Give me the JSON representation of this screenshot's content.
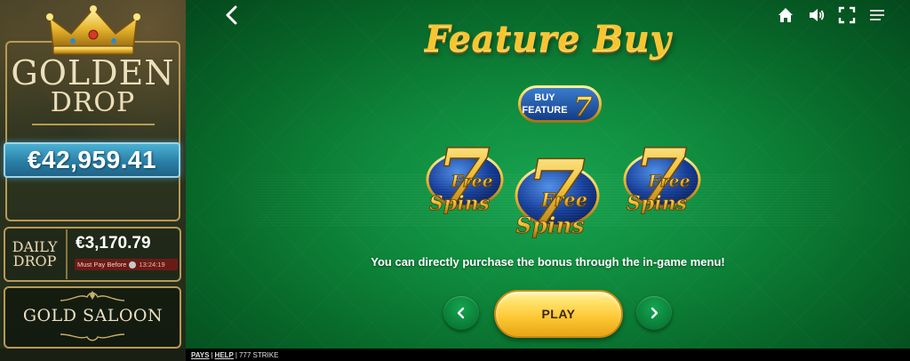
{
  "jackpots": {
    "golden_drop": {
      "line1": "GOLDEN",
      "line2": "DROP",
      "amount": "€42,959.41"
    },
    "daily_drop": {
      "label_line1": "DAILY",
      "label_line2": "DROP",
      "amount": "€3,170.79",
      "must_pay_text": "Must Pay Before",
      "timer": "13:24:19"
    },
    "gold_saloon": {
      "title": "GOLD SALOON"
    }
  },
  "top_bar": {
    "icons": [
      "back-icon",
      "home-icon",
      "sound-icon",
      "fullscreen-icon",
      "menu-icon"
    ]
  },
  "feature": {
    "title": "Feature Buy",
    "badge_line1": "BUY",
    "badge_line2": "FEATURE",
    "badge_number": "7",
    "free_spins_icons": [
      {
        "word1": "Free",
        "word2": "Spins",
        "number": "7"
      },
      {
        "word1": "Free",
        "word2": "Spins",
        "number": "7"
      },
      {
        "word1": "Free",
        "word2": "Spins",
        "number": "7"
      }
    ],
    "description": "You can directly purchase the bonus through the in-game menu!"
  },
  "controls": {
    "play_label": "PLAY",
    "prev_icon": "chevron-left-icon",
    "next_icon": "chevron-right-icon"
  },
  "footer": {
    "pays": "PAYS",
    "help": "HELP",
    "separator": "|",
    "game_name": "777 STRIKE"
  },
  "colors": {
    "felt_green": "#0f8a3d",
    "title_gold": "#f6c531",
    "play_gold": "#fcc632",
    "jackpot_blue": "#2a7fa6",
    "must_pay_red": "#6b1b16"
  }
}
